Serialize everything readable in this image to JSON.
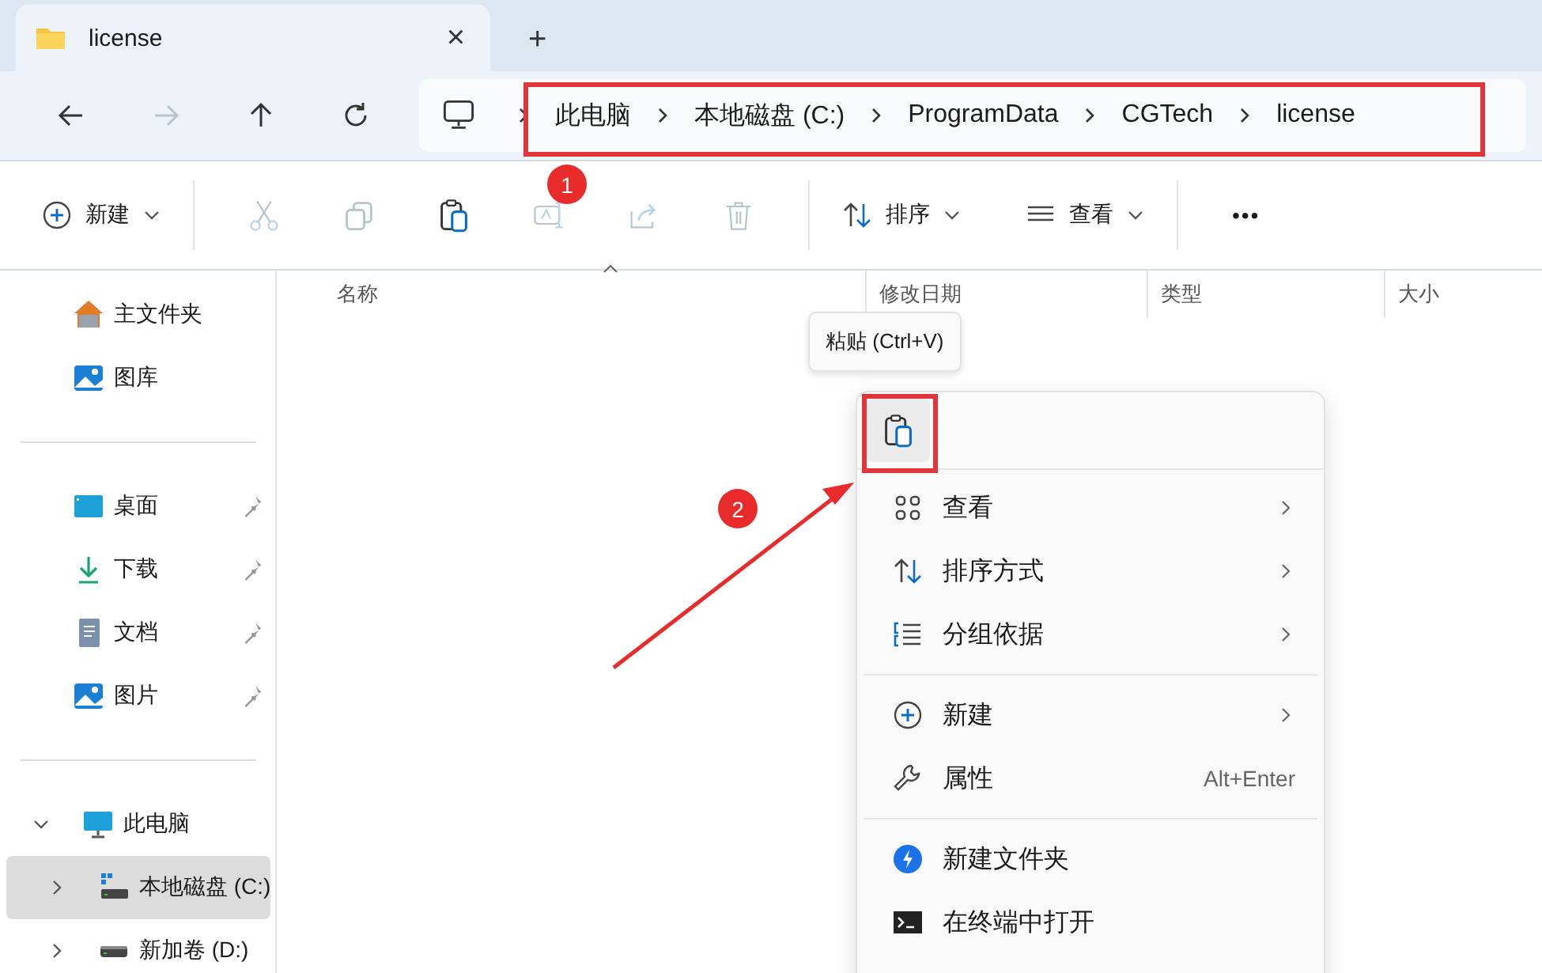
{
  "tab": {
    "title": "license",
    "close": "×",
    "new": "+"
  },
  "nav": [
    {
      "kind": "back",
      "disabled": false
    },
    {
      "kind": "forward",
      "disabled": true
    },
    {
      "kind": "up",
      "disabled": false
    },
    {
      "kind": "refresh",
      "disabled": false
    }
  ],
  "breadcrumb": [
    "此电脑",
    "本地磁盘 (C:)",
    "ProgramData",
    "CGTech",
    "license"
  ],
  "toolbar": {
    "new": "新建",
    "actions": [
      {
        "kind": "cut",
        "disabled": true
      },
      {
        "kind": "copy",
        "disabled": true
      },
      {
        "kind": "paste",
        "disabled": false
      },
      {
        "kind": "rename",
        "disabled": true
      },
      {
        "kind": "share",
        "disabled": true
      },
      {
        "kind": "delete",
        "disabled": true
      }
    ],
    "sort": "排序",
    "view": "查看",
    "more": "•••"
  },
  "columns": [
    {
      "label": "名称",
      "sorted": true
    },
    {
      "label": "修改日期",
      "sorted": false
    },
    {
      "label": "类型",
      "sorted": false
    },
    {
      "label": "大小",
      "sorted": false
    }
  ],
  "sidebar": {
    "sections": [
      [
        {
          "kind": "home",
          "label": "主文件夹",
          "pinned": false
        },
        {
          "kind": "gallery",
          "label": "图库",
          "pinned": false
        }
      ],
      [
        {
          "kind": "desktop",
          "label": "桌面",
          "pinned": true
        },
        {
          "kind": "downloads",
          "label": "下载",
          "pinned": true
        },
        {
          "kind": "documents",
          "label": "文档",
          "pinned": true
        },
        {
          "kind": "pictures",
          "label": "图片",
          "pinned": true
        }
      ],
      [
        {
          "kind": "pc",
          "label": "此电脑",
          "expanded": true,
          "selected": false,
          "children": [
            {
              "kind": "system-drive",
              "label": "本地磁盘 (C:)",
              "expanded": false,
              "selected": true
            },
            {
              "kind": "drive",
              "label": "新加卷 (D:)",
              "expanded": false,
              "selected": false
            }
          ]
        }
      ]
    ]
  },
  "tooltip": "粘贴 (Ctrl+V)",
  "context_menu": {
    "top": [
      {
        "kind": "paste",
        "selected": true
      }
    ],
    "groups": [
      [
        {
          "kind": "view",
          "label": "查看",
          "submenu": true
        },
        {
          "kind": "sort",
          "label": "排序方式",
          "submenu": true
        },
        {
          "kind": "group",
          "label": "分组依据",
          "submenu": true
        }
      ],
      [
        {
          "kind": "new",
          "label": "新建",
          "submenu": true
        },
        {
          "kind": "properties",
          "label": "属性",
          "shortcut": "Alt+Enter",
          "submenu": false
        }
      ],
      [
        {
          "kind": "new-folder",
          "label": "新建文件夹",
          "submenu": false
        },
        {
          "kind": "terminal",
          "label": "在终端中打开",
          "submenu": false
        }
      ]
    ]
  },
  "callouts": [
    {
      "label": "1"
    },
    {
      "label": "2"
    }
  ]
}
